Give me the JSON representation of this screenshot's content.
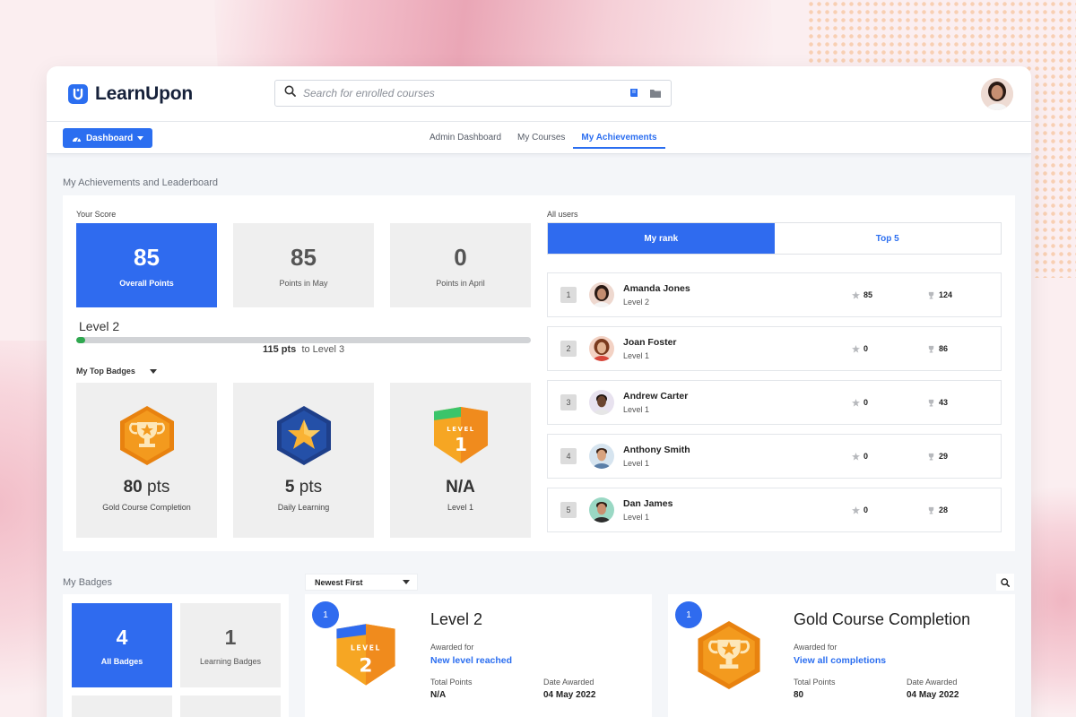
{
  "colors": {
    "accent": "#2f6bef",
    "progress": "#2fa84f"
  },
  "header": {
    "logo_text": "LearnUpon",
    "search_placeholder": "Search for enrolled courses"
  },
  "nav": {
    "dashboard_label": "Dashboard",
    "tabs": [
      {
        "label": "Admin Dashboard"
      },
      {
        "label": "My Courses"
      },
      {
        "label": "My Achievements",
        "active": true
      }
    ]
  },
  "page_title": "My Achievements and Leaderboard",
  "score": {
    "label": "Your Score",
    "cards": [
      {
        "value": "85",
        "label": "Overall Points"
      },
      {
        "value": "85",
        "label": "Points in May"
      },
      {
        "value": "0",
        "label": "Points in April"
      }
    ],
    "level": "Level 2",
    "progress_fraction": 0.02,
    "progress_pts": "115 pts",
    "progress_suffix": "to Level 3"
  },
  "top_badges": {
    "label": "My Top Badges",
    "cards": [
      {
        "points": "80",
        "unit": "pts",
        "name": "Gold Course Completion",
        "icon": "gold-trophy-icon"
      },
      {
        "points": "5",
        "unit": "pts",
        "name": "Daily Learning",
        "icon": "star-badge-icon"
      },
      {
        "points": "N/A",
        "unit": "",
        "name": "Level 1",
        "icon": "level-1-badge-icon",
        "badge_word": "LEVEL",
        "badge_num": "1"
      }
    ]
  },
  "leaderboard": {
    "label": "All users",
    "tabs": [
      {
        "label": "My rank",
        "active": true
      },
      {
        "label": "Top 5"
      }
    ],
    "rows": [
      {
        "rank": "1",
        "name": "Amanda Jones",
        "level": "Level 2",
        "points": "85",
        "trophies": "124"
      },
      {
        "rank": "2",
        "name": "Joan Foster",
        "level": "Level 1",
        "points": "0",
        "trophies": "86"
      },
      {
        "rank": "3",
        "name": "Andrew Carter",
        "level": "Level 1",
        "points": "0",
        "trophies": "43"
      },
      {
        "rank": "4",
        "name": "Anthony Smith",
        "level": "Level 1",
        "points": "0",
        "trophies": "29"
      },
      {
        "rank": "5",
        "name": "Dan James",
        "level": "Level 1",
        "points": "0",
        "trophies": "28"
      }
    ]
  },
  "my_badges": {
    "label": "My Badges",
    "cards": [
      {
        "value": "4",
        "label": "All Badges"
      },
      {
        "value": "1",
        "label": "Learning Badges"
      }
    ],
    "sort_label": "Newest First",
    "awards": [
      {
        "count": "1",
        "title": "Level 2",
        "awarded_for_label": "Awarded for",
        "awarded_for": "New level reached",
        "total_points_label": "Total Points",
        "total_points": "N/A",
        "date_label": "Date Awarded",
        "date": "04 May 2022",
        "icon": "level-2-badge-icon",
        "badge_word": "LEVEL",
        "badge_num": "2"
      },
      {
        "count": "1",
        "title": "Gold Course Completion",
        "awarded_for_label": "Awarded for",
        "awarded_for": "View all completions",
        "total_points_label": "Total Points",
        "total_points": "80",
        "date_label": "Date Awarded",
        "date": "04 May 2022",
        "icon": "gold-trophy-icon"
      }
    ]
  }
}
